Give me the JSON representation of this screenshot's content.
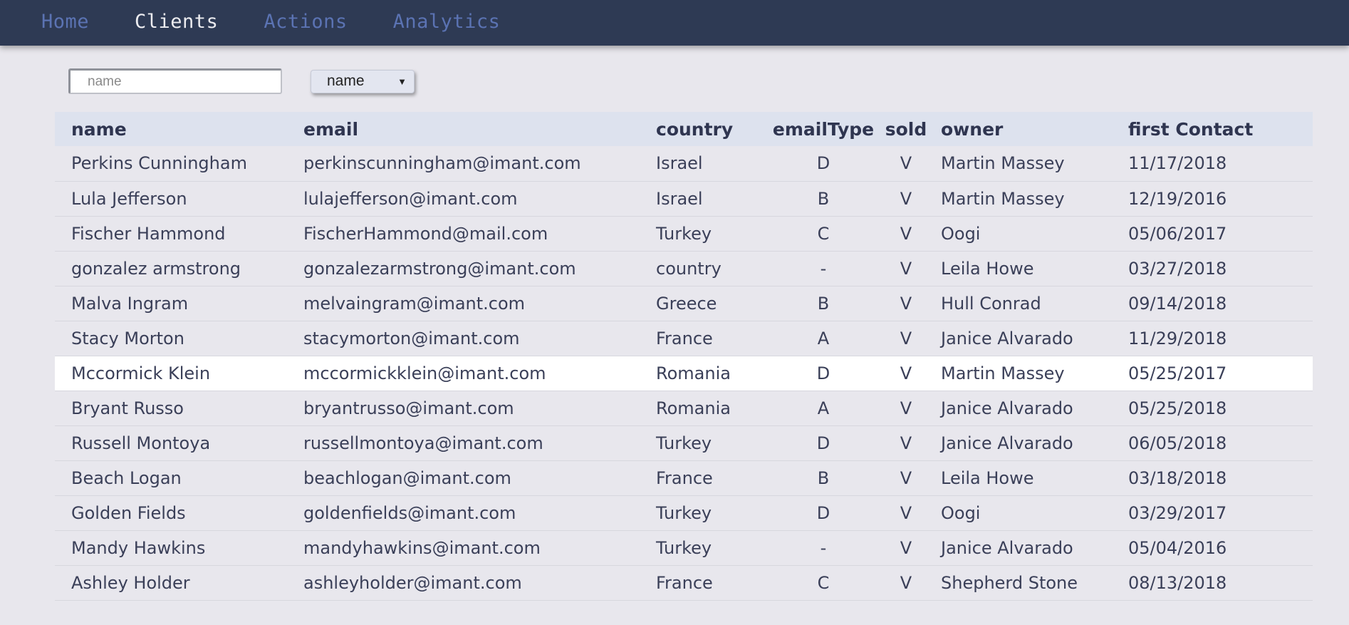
{
  "nav": {
    "items": [
      {
        "label": "Home"
      },
      {
        "label": "Clients"
      },
      {
        "label": "Actions"
      },
      {
        "label": "Analytics"
      }
    ],
    "active": "Clients"
  },
  "toolbar": {
    "search_placeholder": "name",
    "sort_value": "name"
  },
  "table": {
    "headers": [
      "name",
      "email",
      "country",
      "emailType",
      "sold",
      "owner",
      "first Contact"
    ],
    "rows": [
      [
        "Perkins Cunningham",
        "perkinscunningham@imant.com",
        "Israel",
        "D",
        "V",
        "Martin Massey",
        "11/17/2018"
      ],
      [
        "Lula Jefferson",
        "lulajefferson@imant.com",
        "Israel",
        "B",
        "V",
        "Martin Massey",
        "12/19/2016"
      ],
      [
        "Fischer Hammond",
        "FischerHammond@mail.com",
        "Turkey",
        "C",
        "V",
        "Oogi",
        "05/06/2017"
      ],
      [
        "gonzalez armstrong",
        "gonzalezarmstrong@imant.com",
        "country",
        "-",
        "V",
        "Leila Howe",
        "03/27/2018"
      ],
      [
        "Malva Ingram",
        "melvaingram@imant.com",
        "Greece",
        "B",
        "V",
        "Hull Conrad",
        "09/14/2018"
      ],
      [
        "Stacy Morton",
        "stacymorton@imant.com",
        "France",
        "A",
        "V",
        "Janice Alvarado",
        "11/29/2018"
      ],
      [
        "Mccormick Klein",
        "mccormickklein@imant.com",
        "Romania",
        "D",
        "V",
        "Martin Massey",
        "05/25/2017"
      ],
      [
        "Bryant Russo",
        "bryantrusso@imant.com",
        "Romania",
        "A",
        "V",
        "Janice Alvarado",
        "05/25/2018"
      ],
      [
        "Russell Montoya",
        "russellmontoya@imant.com",
        "Turkey",
        "D",
        "V",
        "Janice Alvarado",
        "06/05/2018"
      ],
      [
        "Beach Logan",
        "beachlogan@imant.com",
        "France",
        "B",
        "V",
        "Leila Howe",
        "03/18/2018"
      ],
      [
        "Golden Fields",
        "goldenfields@imant.com",
        "Turkey",
        "D",
        "V",
        "Oogi",
        "03/29/2017"
      ],
      [
        "Mandy Hawkins",
        "mandyhawkins@imant.com",
        "Turkey",
        "-",
        "V",
        "Janice Alvarado",
        "05/04/2016"
      ],
      [
        "Ashley Holder",
        "ashleyholder@imant.com",
        "France",
        "C",
        "V",
        "Shepherd Stone",
        "08/13/2018"
      ]
    ],
    "highlighted_row": 6
  },
  "colors": {
    "navbar_bg": "#2e3a54",
    "nav_link": "#5b73b3",
    "nav_active": "#ececf0",
    "page_bg": "#e8e7ed",
    "header_row_bg": "#dde2ee",
    "highlight_row_bg": "#ffffff"
  }
}
